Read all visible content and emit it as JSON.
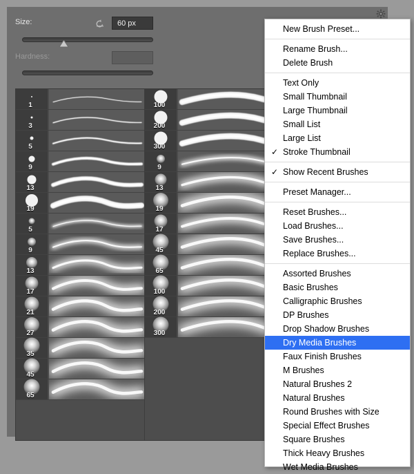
{
  "panel": {
    "size": {
      "label": "Size:",
      "value": "60 px",
      "reset_icon": "reset-arrow-icon",
      "slider_position_percent": 30
    },
    "hardness": {
      "label": "Hardness:",
      "value": "",
      "enabled": false
    },
    "gear_icon": "gear-icon"
  },
  "brushes": {
    "column1": [
      {
        "size": "1",
        "dot": 2
      },
      {
        "size": "3",
        "dot": 3
      },
      {
        "size": "5",
        "dot": 5
      },
      {
        "size": "9",
        "dot": 9
      },
      {
        "size": "13",
        "dot": 13
      },
      {
        "size": "19",
        "dot": 18
      },
      {
        "size": "5",
        "dot": 5
      },
      {
        "size": "9",
        "dot": 8
      },
      {
        "size": "13",
        "dot": 12
      },
      {
        "size": "17",
        "dot": 15
      },
      {
        "size": "21",
        "dot": 17
      },
      {
        "size": "27",
        "dot": 18
      },
      {
        "size": "35",
        "dot": 19
      },
      {
        "size": "45",
        "dot": 19
      },
      {
        "size": "65",
        "dot": 19
      }
    ],
    "column2": [
      {
        "size": "100",
        "dot": 19
      },
      {
        "size": "200",
        "dot": 19
      },
      {
        "size": "300",
        "dot": 19
      },
      {
        "size": "9",
        "dot": 8
      },
      {
        "size": "13",
        "dot": 13
      },
      {
        "size": "19",
        "dot": 18
      },
      {
        "size": "17",
        "dot": 15
      },
      {
        "size": "45",
        "dot": 19
      },
      {
        "size": "65",
        "dot": 19
      },
      {
        "size": "100",
        "dot": 19
      },
      {
        "size": "200",
        "dot": 19
      },
      {
        "size": "300",
        "dot": 19
      }
    ]
  },
  "menu": {
    "groups": [
      {
        "items": [
          {
            "label": "New Brush Preset...",
            "checked": false,
            "selected": false
          }
        ]
      },
      {
        "items": [
          {
            "label": "Rename Brush...",
            "checked": false,
            "selected": false
          },
          {
            "label": "Delete Brush",
            "checked": false,
            "selected": false
          }
        ]
      },
      {
        "items": [
          {
            "label": "Text Only",
            "checked": false,
            "selected": false
          },
          {
            "label": "Small Thumbnail",
            "checked": false,
            "selected": false
          },
          {
            "label": "Large Thumbnail",
            "checked": false,
            "selected": false
          },
          {
            "label": "Small List",
            "checked": false,
            "selected": false
          },
          {
            "label": "Large List",
            "checked": false,
            "selected": false
          },
          {
            "label": "Stroke Thumbnail",
            "checked": true,
            "selected": false
          }
        ]
      },
      {
        "items": [
          {
            "label": "Show Recent Brushes",
            "checked": true,
            "selected": false
          }
        ]
      },
      {
        "items": [
          {
            "label": "Preset Manager...",
            "checked": false,
            "selected": false
          }
        ]
      },
      {
        "items": [
          {
            "label": "Reset Brushes...",
            "checked": false,
            "selected": false
          },
          {
            "label": "Load Brushes...",
            "checked": false,
            "selected": false
          },
          {
            "label": "Save Brushes...",
            "checked": false,
            "selected": false
          },
          {
            "label": "Replace Brushes...",
            "checked": false,
            "selected": false
          }
        ]
      },
      {
        "items": [
          {
            "label": "Assorted Brushes",
            "checked": false,
            "selected": false
          },
          {
            "label": "Basic Brushes",
            "checked": false,
            "selected": false
          },
          {
            "label": "Calligraphic Brushes",
            "checked": false,
            "selected": false
          },
          {
            "label": "DP Brushes",
            "checked": false,
            "selected": false
          },
          {
            "label": "Drop Shadow Brushes",
            "checked": false,
            "selected": false
          },
          {
            "label": "Dry Media Brushes",
            "checked": false,
            "selected": true
          },
          {
            "label": "Faux Finish Brushes",
            "checked": false,
            "selected": false
          },
          {
            "label": "M Brushes",
            "checked": false,
            "selected": false
          },
          {
            "label": "Natural Brushes 2",
            "checked": false,
            "selected": false
          },
          {
            "label": "Natural Brushes",
            "checked": false,
            "selected": false
          },
          {
            "label": "Round Brushes with Size",
            "checked": false,
            "selected": false
          },
          {
            "label": "Special Effect Brushes",
            "checked": false,
            "selected": false
          },
          {
            "label": "Square Brushes",
            "checked": false,
            "selected": false
          },
          {
            "label": "Thick Heavy Brushes",
            "checked": false,
            "selected": false
          },
          {
            "label": "Wet Media Brushes",
            "checked": false,
            "selected": false
          }
        ]
      }
    ],
    "check_glyph": "✓",
    "highlight_color": "#2e6ff2"
  }
}
